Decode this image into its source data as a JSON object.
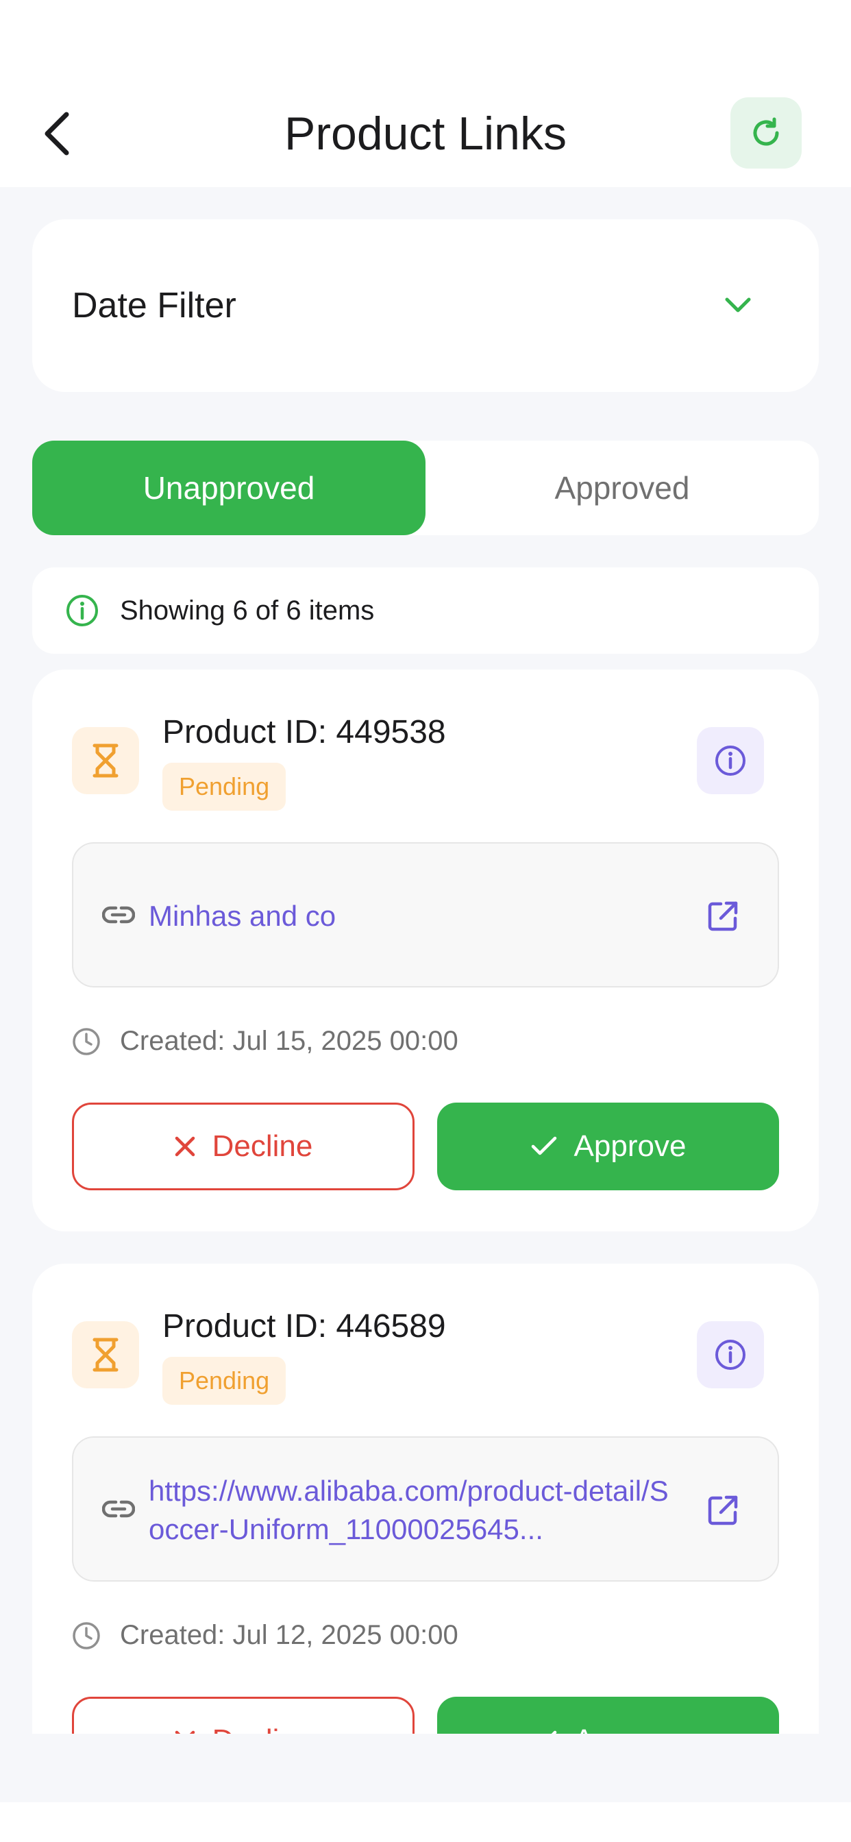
{
  "header": {
    "title": "Product Links",
    "back_icon": "chevron-left-icon",
    "refresh_icon": "refresh-icon"
  },
  "date_filter": {
    "label": "Date Filter",
    "icon": "chevron-down-icon"
  },
  "tabs": [
    {
      "label": "Unapproved",
      "active": true
    },
    {
      "label": "Approved",
      "active": false
    }
  ],
  "info": {
    "text": "Showing 6 of 6 items",
    "icon": "info-circle-icon"
  },
  "products": [
    {
      "title": "Product ID: 449538",
      "status": "Pending",
      "link": "Minhas and co",
      "created": "Created: Jul 15, 2025 00:00",
      "decline_label": "Decline",
      "approve_label": "Approve"
    },
    {
      "title": "Product ID: 446589",
      "status": "Pending",
      "link": "https://www.alibaba.com/product-detail/Soccer-Uniform_11000025645...",
      "created": "Created: Jul 12, 2025 00:00",
      "decline_label": "Decline",
      "approve_label": "Approve"
    }
  ],
  "colors": {
    "primary_green": "#35b44d",
    "decline_red": "#e0453b",
    "pending_orange": "#f0a030",
    "link_purple": "#6b5ad9"
  }
}
